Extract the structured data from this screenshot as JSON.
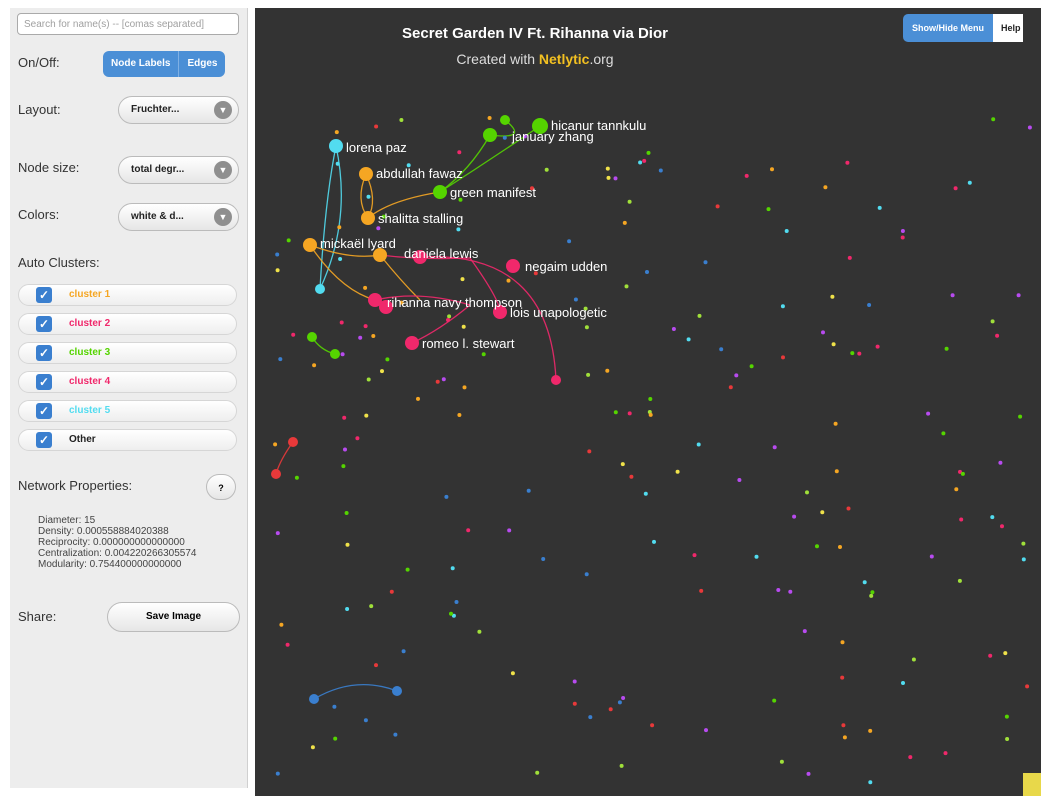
{
  "search": {
    "placeholder": "Search for name(s) -- [comas separated]"
  },
  "onoff": {
    "label": "On/Off:",
    "node_labels": "Node Labels",
    "edges": "Edges"
  },
  "layout": {
    "label": "Layout:",
    "value": "Fruchter..."
  },
  "node_size": {
    "label": "Node size:",
    "value": "total degr..."
  },
  "colors": {
    "label": "Colors:",
    "value": "white & d..."
  },
  "auto_clusters": {
    "label": "Auto Clusters:",
    "items": [
      {
        "name": "cluster 1",
        "color": "#f5a623"
      },
      {
        "name": "cluster 2",
        "color": "#f0286b"
      },
      {
        "name": "cluster 3",
        "color": "#55d400"
      },
      {
        "name": "cluster 4",
        "color": "#f0286b"
      },
      {
        "name": "cluster 5",
        "color": "#52dcf0"
      },
      {
        "name": "Other",
        "color": "#222222"
      }
    ]
  },
  "network_properties": {
    "label": "Network Properties:",
    "help": "?",
    "lines": [
      "Diameter: 15",
      "Density: 0.000558884020388",
      "Reciprocity: 0.000000000000000",
      "Centralization: 0.004220266305574",
      "Modularity: 0.754400000000000"
    ]
  },
  "share": {
    "label": "Share:",
    "save": "Save Image"
  },
  "graph": {
    "title": "Secret Garden IV Ft. Rihanna via Dior",
    "subtitle_prefix": "Created with ",
    "subtitle_brand": "Netlytic",
    "subtitle_suffix": ".org",
    "show_hide": "Show/Hide Menu",
    "help": "Help",
    "labels": [
      "hicanur tannkulu",
      "january zhang",
      "lorena paz",
      "abdullah fawaz",
      "green manifest",
      "shalitta stalling",
      "mickaël lyard",
      "daniela lewis",
      "negaim udden",
      "rihanna navy thompson",
      "lois unapologetic",
      "romeo l. stewart"
    ]
  }
}
